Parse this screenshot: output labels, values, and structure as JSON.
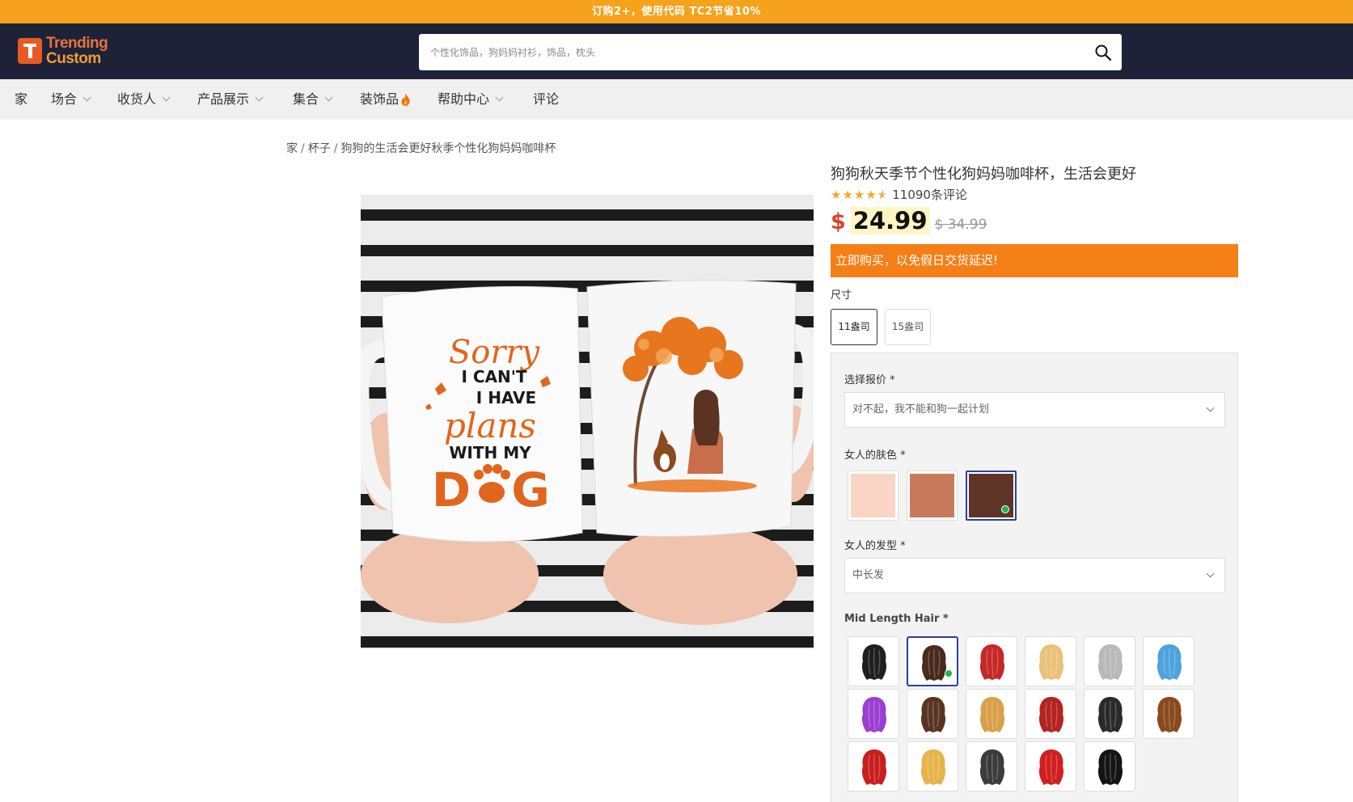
{
  "promo": {
    "text": "订购2+，使用代码 TC2节省10%"
  },
  "header": {
    "logo_line1": "Trending",
    "logo_line2": "Custom",
    "search_placeholder": "个性化饰品，狗妈妈衬衫，饰品，枕头",
    "search_icon": "search-icon"
  },
  "nav": {
    "items": [
      {
        "label": "家",
        "dropdown": false
      },
      {
        "label": "场合",
        "dropdown": true
      },
      {
        "label": "收货人",
        "dropdown": true
      },
      {
        "label": "产品展示",
        "dropdown": true
      },
      {
        "label": "集合",
        "dropdown": true
      },
      {
        "label": "装饰品",
        "dropdown": false,
        "icon": "flame-icon"
      },
      {
        "label": "帮助中心",
        "dropdown": true
      },
      {
        "label": "评论",
        "dropdown": false
      }
    ]
  },
  "breadcrumb": {
    "home": "家",
    "category": "杯子",
    "current": "狗狗的生活会更好秋季个性化狗妈妈咖啡杯"
  },
  "product": {
    "title": "狗狗秋天季节个性化狗妈妈咖啡杯，生活会更好",
    "rating": 4.5,
    "review_count": "11090条评论",
    "currency": "$",
    "price": "24.99",
    "old_price": "$ 34.99",
    "urgency": "立即购买，以免假日交货延迟!",
    "mug_text": {
      "line1": "Sorry",
      "line2": "I CAN'T",
      "line3": "I HAVE",
      "line4": "plans",
      "line5": "WITH MY",
      "line6_a": "D",
      "line6_b": "G"
    }
  },
  "size": {
    "label": "尺寸",
    "options": [
      {
        "label": "11盎司",
        "selected": true
      },
      {
        "label": "15盎司",
        "selected": false
      }
    ]
  },
  "customize": {
    "quote_label": "选择报价 *",
    "quote_value": "对不起，我不能和狗一起计划",
    "skin_label": "女人的肤色 *",
    "skin_colors": [
      {
        "color": "#fad4c4",
        "selected": false
      },
      {
        "color": "#c77b5c",
        "selected": false
      },
      {
        "color": "#5e3526",
        "selected": true
      }
    ],
    "hairstyle_label": "女人的发型 *",
    "hairstyle_value": "中长发",
    "hair_label": "Mid Length Hair *",
    "hair_colors": [
      {
        "color": "#1f1f1f",
        "selected": false
      },
      {
        "color": "#4a2a1c",
        "selected": true
      },
      {
        "color": "#c62828",
        "selected": false
      },
      {
        "color": "#e8c27a",
        "selected": false
      },
      {
        "color": "#b9b9b9",
        "selected": false
      },
      {
        "color": "#4ea3dc",
        "selected": false
      },
      {
        "color": "#9b3fd1",
        "selected": false
      },
      {
        "color": "#5a3422",
        "selected": false
      },
      {
        "color": "#d9a04a",
        "selected": false
      },
      {
        "color": "#b3241f",
        "selected": false
      },
      {
        "color": "#2a2a2a",
        "selected": false
      },
      {
        "color": "#8a4a1f",
        "selected": false
      },
      {
        "color": "#c81e1e",
        "selected": false
      },
      {
        "color": "#e6b44a",
        "selected": false
      },
      {
        "color": "#3b3b3b",
        "selected": false
      },
      {
        "color": "#d11f1f",
        "selected": false
      },
      {
        "color": "#141414",
        "selected": false
      }
    ]
  },
  "colors": {
    "promo_bg": "#f5a21c",
    "header_bg": "#1d2238",
    "accent_orange": "#f57f17",
    "price_red": "#d9432e",
    "star": "#f5a623"
  }
}
